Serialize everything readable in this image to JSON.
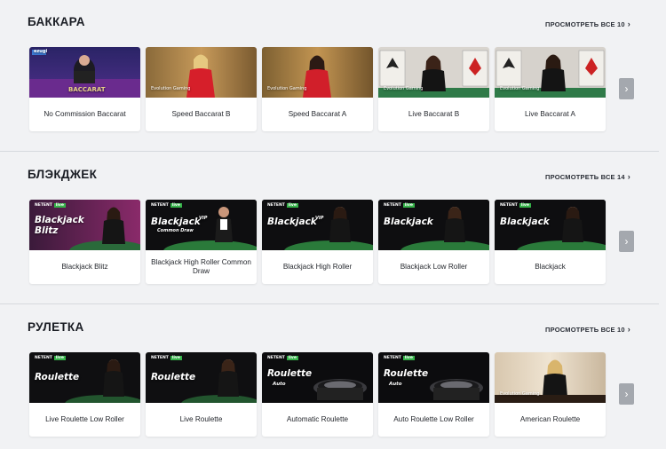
{
  "sections": [
    {
      "title": "БАККАРА",
      "view_all": "ПРОСМОТРЕТЬ ВСЕ 10",
      "cards": [
        {
          "label": "No Commission Baccarat",
          "thumb": "baccarat-ezugi",
          "overlay": "BACCARAT",
          "brand": "ezugi"
        },
        {
          "label": "Speed Baccarat B",
          "thumb": "speed-baccarat-b",
          "overlay": "",
          "brand": "Evolution Gaming"
        },
        {
          "label": "Speed Baccarat A",
          "thumb": "speed-baccarat-a",
          "overlay": "",
          "brand": "Evolution Gaming"
        },
        {
          "label": "Live Baccarat B",
          "thumb": "live-baccarat-b",
          "overlay": "",
          "brand": "Evolution Gaming"
        },
        {
          "label": "Live Baccarat A",
          "thumb": "live-baccarat-a",
          "overlay": "",
          "brand": "Evolution Gaming"
        }
      ]
    },
    {
      "title": "БЛЭКДЖЕК",
      "view_all": "ПРОСМОТРЕТЬ ВСЕ 14",
      "cards": [
        {
          "label": "Blackjack Blitz",
          "thumb": "blackjack-blitz",
          "overlay": "Blackjack Blitz",
          "brand": "NETENT live"
        },
        {
          "label": "Blackjack High Roller Common Draw",
          "thumb": "blackjack-vip-common",
          "overlay": "Blackjack",
          "brand": "NETENT live"
        },
        {
          "label": "Blackjack High Roller",
          "thumb": "blackjack-vip",
          "overlay": "Blackjack",
          "brand": "NETENT live"
        },
        {
          "label": "Blackjack Low Roller",
          "thumb": "blackjack-low",
          "overlay": "Blackjack",
          "brand": "NETENT live"
        },
        {
          "label": "Blackjack",
          "thumb": "blackjack",
          "overlay": "Blackjack",
          "brand": "NETENT live"
        }
      ]
    },
    {
      "title": "РУЛЕТКА",
      "view_all": "ПРОСМОТРЕТЬ ВСЕ 10",
      "cards": [
        {
          "label": "Live Roulette Low Roller",
          "thumb": "roulette-low",
          "overlay": "Roulette",
          "brand": "NETENT live"
        },
        {
          "label": "Live Roulette",
          "thumb": "roulette",
          "overlay": "Roulette",
          "brand": "NETENT live"
        },
        {
          "label": "Automatic Roulette",
          "thumb": "roulette-auto",
          "overlay": "Roulette",
          "brand": "NETENT live"
        },
        {
          "label": "Auto Roulette Low Roller",
          "thumb": "roulette-auto-low",
          "overlay": "Roulette",
          "brand": "NETENT live"
        },
        {
          "label": "American Roulette",
          "thumb": "american-roulette",
          "overlay": "",
          "brand": "Evolution Gaming"
        }
      ]
    }
  ],
  "thumb_extras": {
    "vip": "VIP",
    "common_draw": "Common Draw",
    "auto": "Auto",
    "netent": "NETENT",
    "live": "live"
  },
  "icons": {
    "next": "chevron-right-icon"
  },
  "colors": {
    "background": "#f1f2f4",
    "button": "#a4a8ae",
    "live_badge": "#36b24a"
  }
}
